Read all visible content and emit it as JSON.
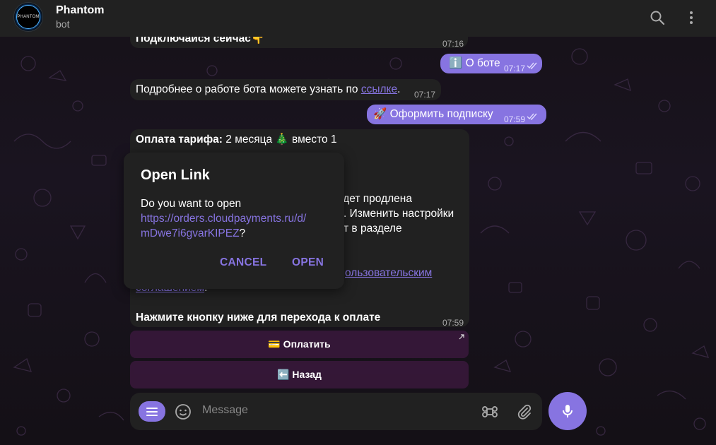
{
  "header": {
    "avatar_text": "PHANTOM",
    "title": "Phantom",
    "subtitle": "bot"
  },
  "messages": {
    "m1": {
      "text": "Подключайся сейчас👇",
      "time": "07:16"
    },
    "m2": {
      "text": "ℹ️  О боте",
      "time": "07:17"
    },
    "m3": {
      "text": "Подробнее о работе бота можете узнать по ",
      "link": "ссылке",
      "suffix": ".",
      "time": "07:17"
    },
    "m4": {
      "text": "🚀  Оформить подписку",
      "time": "07:59"
    },
    "m5": {
      "line1_bold": "Оплата тарифа:",
      "line1_rest": " 2 месяца 🎄  вместо 1",
      "line_a": "удет продлена",
      "line_b": ". Изменить настройки",
      "line_c": "т в разделе",
      "link_a": "ользовательским",
      "link_b": "соглашением",
      "link_suffix": ".",
      "last_line": "Нажмите кнопку ниже для перехода к оплате",
      "time": "07:59"
    }
  },
  "keyboard": {
    "pay_label": "💳  Оплатить",
    "back_label": "⬅️  Назад"
  },
  "composer": {
    "placeholder": "Message"
  },
  "dialog": {
    "title": "Open Link",
    "prompt": "Do you want to open",
    "url_line1": "https://orders.cloudpayments.ru/d/",
    "url_line2": "mDwe7i6gvarKIPEZ",
    "question_mark": "?",
    "cancel_label": "CANCEL",
    "open_label": "OPEN"
  },
  "colors": {
    "accent": "#8774e1",
    "bubble_in": "#212121",
    "header_bg": "#212121"
  }
}
